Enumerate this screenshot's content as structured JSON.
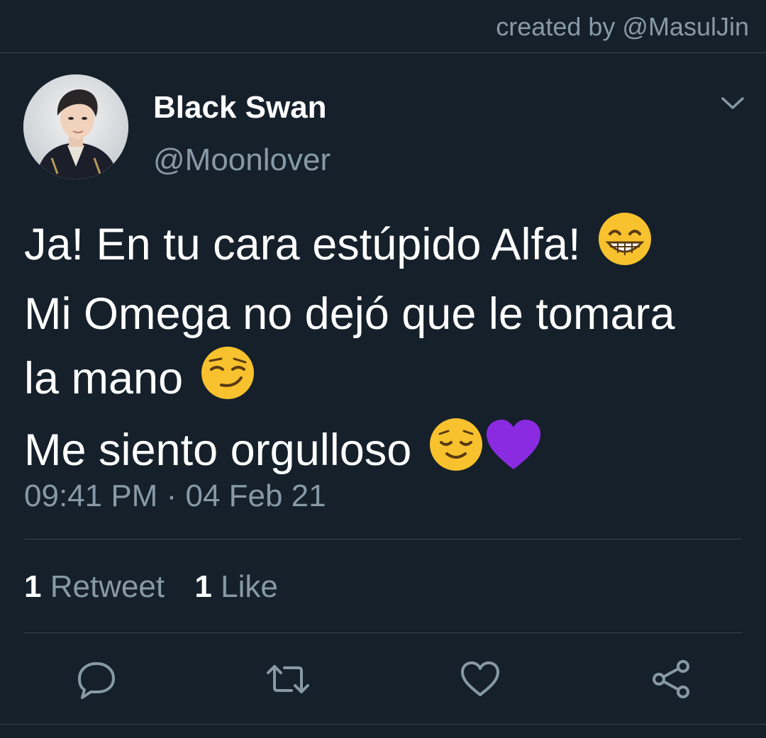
{
  "header": {
    "credit": "created by @MasulJin"
  },
  "tweet": {
    "display_name": "Black Swan",
    "handle": "@Moonlover",
    "lines": [
      "Ja! En tu cara estúpido Alfa!",
      "Mi Omega no dejó que le tomara",
      "la mano",
      "Me siento orgulloso"
    ],
    "emojis": [
      "beaming-face-emoji",
      "smirking-face-emoji",
      "relieved-face-emoji",
      "purple-heart-emoji"
    ],
    "time": "09:41 PM",
    "separator": "·",
    "date": "04 Feb 21",
    "retweets_count": "1",
    "retweets_label": "Retweet",
    "likes_count": "1",
    "likes_label": "Like"
  },
  "actions": [
    "reply-icon",
    "retweet-icon",
    "like-icon",
    "share-icon"
  ],
  "colors": {
    "background": "#15202b",
    "secondary_text": "#8899a6",
    "divider": "#38444d",
    "purple_heart": "#8a2be2",
    "emoji_yellow": "#f7c22d"
  }
}
